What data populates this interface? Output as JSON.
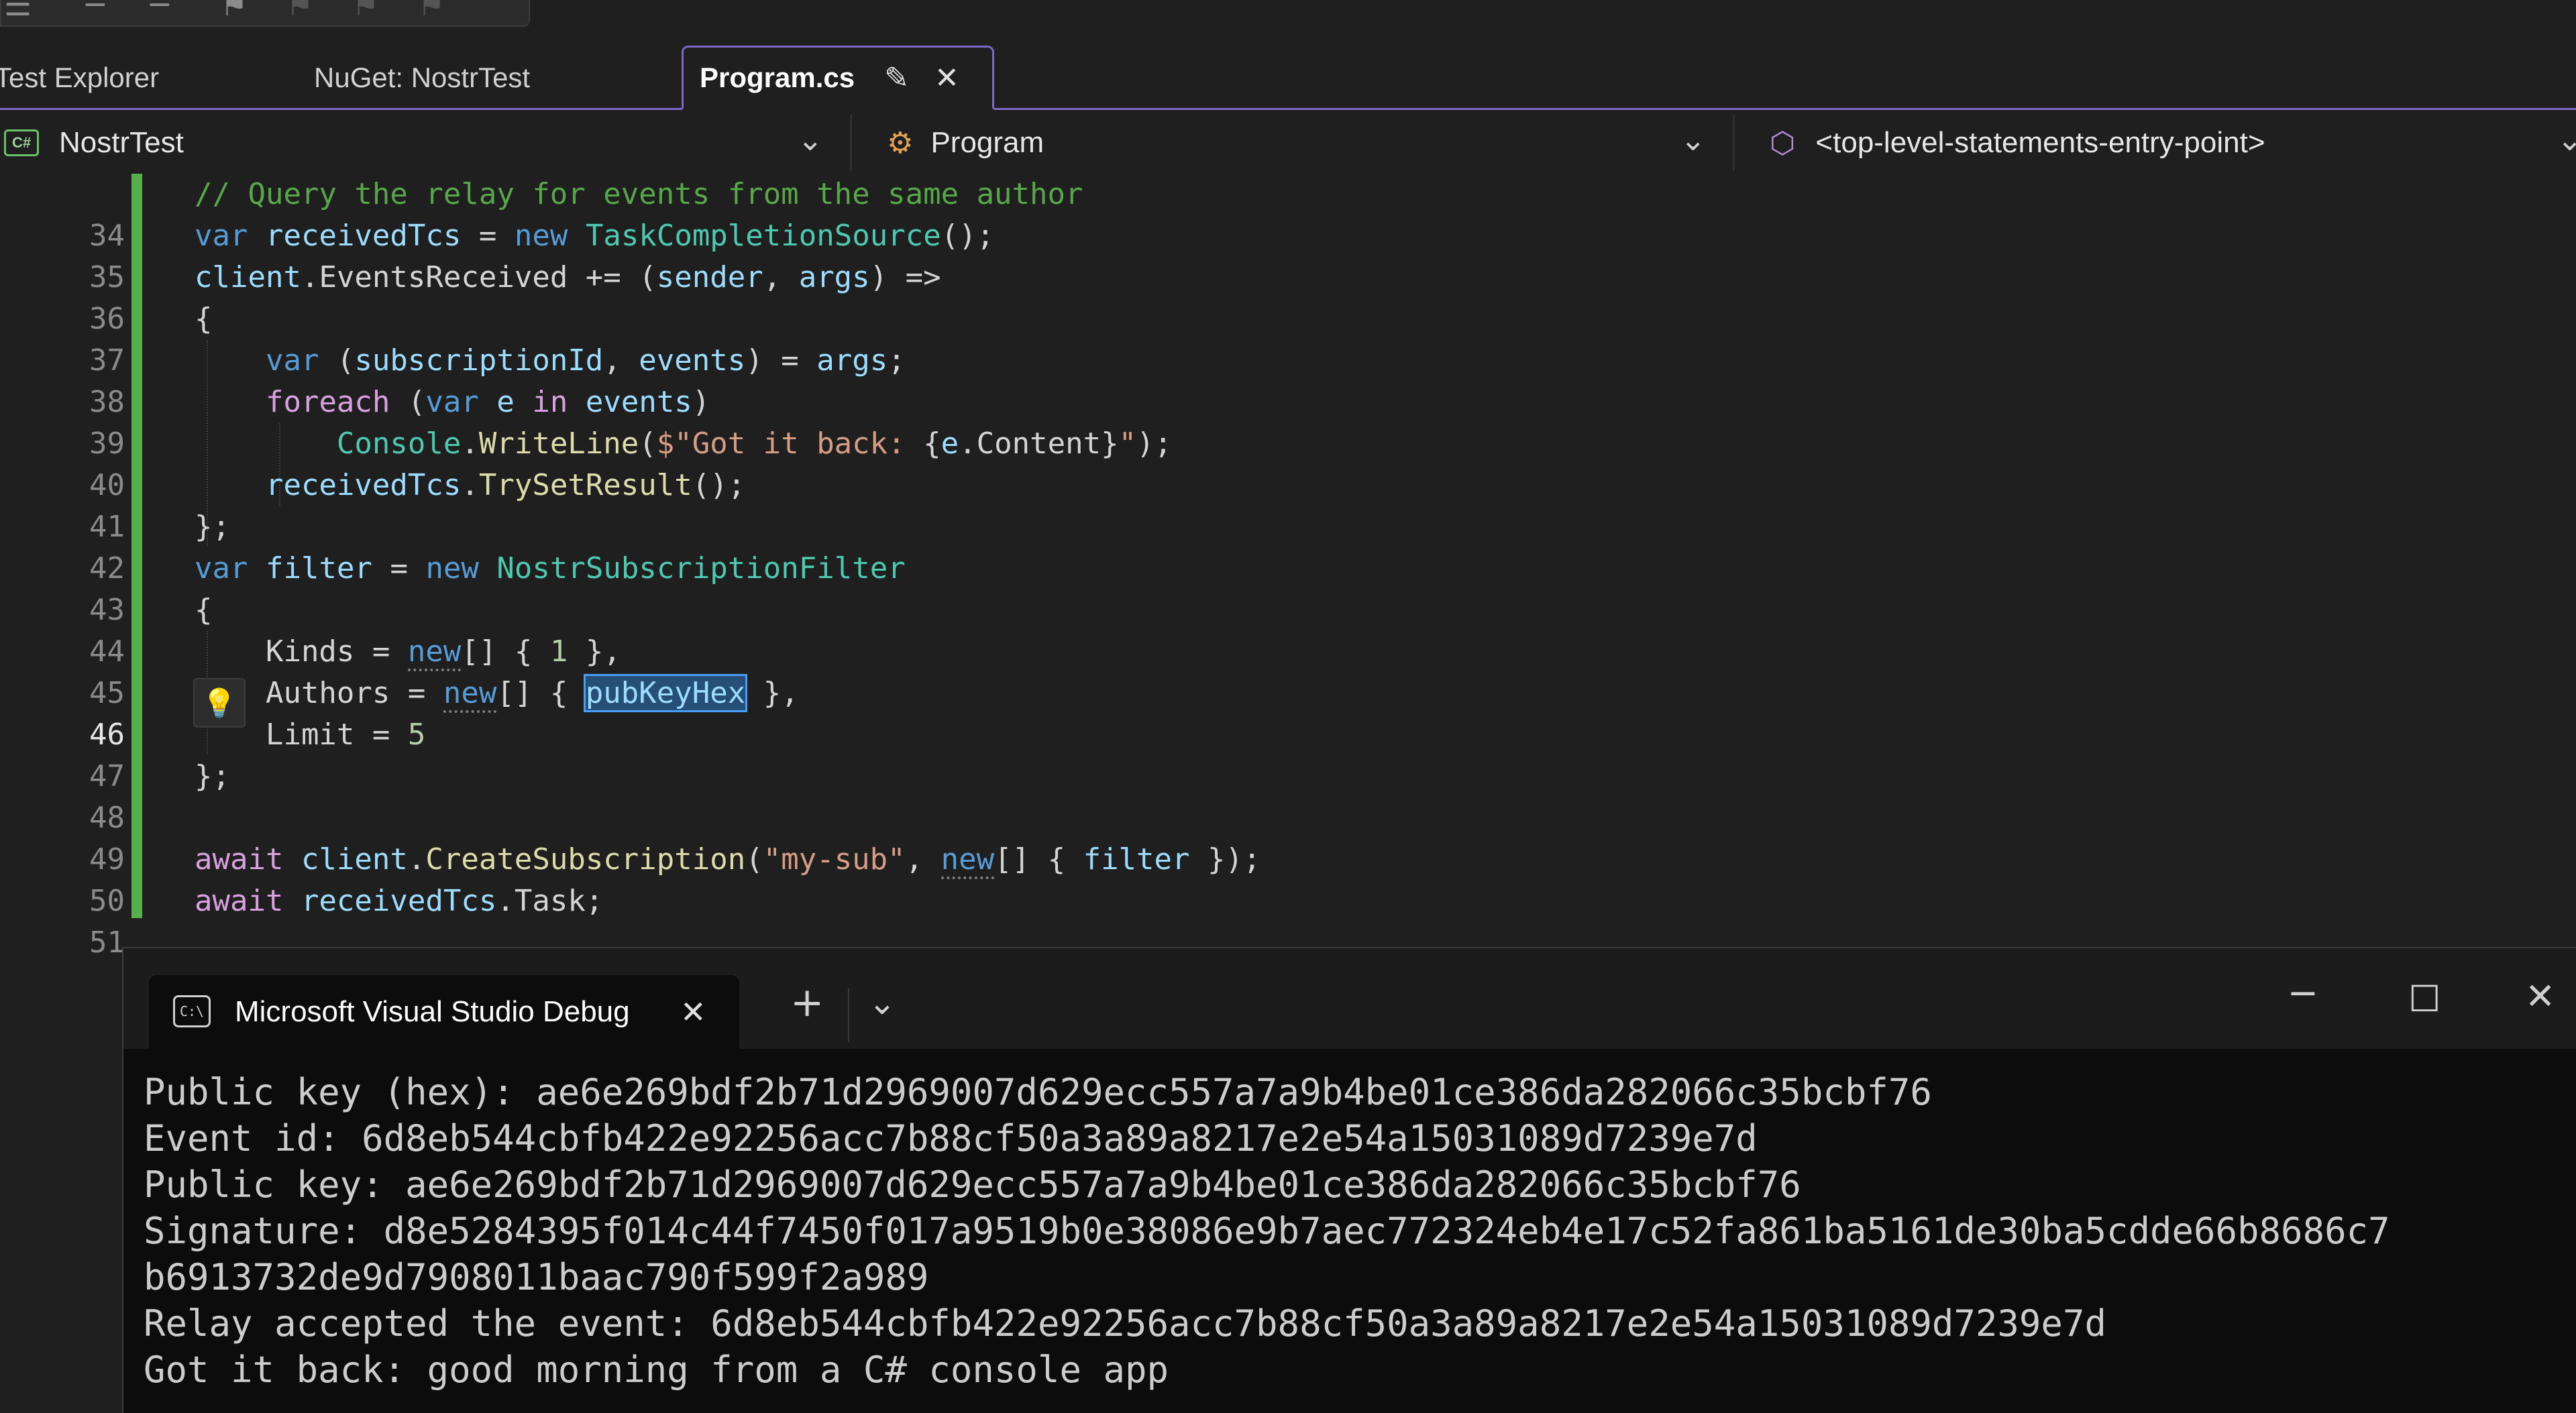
{
  "tabs": [
    {
      "label": "Test Explorer"
    },
    {
      "label": "NuGet: NostrTest"
    },
    {
      "label": "Program.cs",
      "active": true
    }
  ],
  "navbar": {
    "project": "NostrTest",
    "project_badge": "C#",
    "class": "Program",
    "member": "<top-level-statements-entry-point>"
  },
  "editor": {
    "current_line": 46,
    "selected_text": "pubKeyHex",
    "line_numbers": [
      "34",
      "35",
      "36",
      "37",
      "38",
      "39",
      "40",
      "41",
      "42",
      "43",
      "44",
      "45",
      "46",
      "47",
      "48",
      "49",
      "50",
      "51"
    ]
  },
  "terminal": {
    "tab_title": "Microsoft Visual Studio Debug Console",
    "tab_icon_text": "C:\\",
    "output": [
      "Public key (hex): ae6e269bdf2b71d2969007d629ecc557a7a9b4be01ce386da282066c35bcbf76",
      "Event id: 6d8eb544cbfb422e92256acc7b88cf50a3a89a8217e2e54a15031089d7239e7d",
      "Public key: ae6e269bdf2b71d2969007d629ecc557a7a9b4be01ce386da282066c35bcbf76",
      "Signature: d8e5284395f014c44f7450f017a9519b0e38086e9b7aec772324eb4e17c52fa861ba5161de30ba5cdde66b8686c7",
      "b6913732de9d7908011baac790f599f2a989",
      "Relay accepted the event: 6d8eb544cbfb422e92256acc7b88cf50a3a89a8217e2e54a15031089d7239e7d",
      "Got it back: good morning from a C# console app"
    ]
  },
  "icons": {
    "pin": "pin-icon",
    "close": "close-icon",
    "chevron": "chevron-down-icon",
    "lightbulb": "lightbulb-icon",
    "add": "plus-icon",
    "minimize": "minimize-icon",
    "maximize": "maximize-icon"
  },
  "colors": {
    "accent": "#7b68c8",
    "change_bar": "#56b14c",
    "keyword": "#569cd6",
    "type": "#4ec9b0",
    "comment": "#57a64a",
    "string": "#d69d85"
  }
}
